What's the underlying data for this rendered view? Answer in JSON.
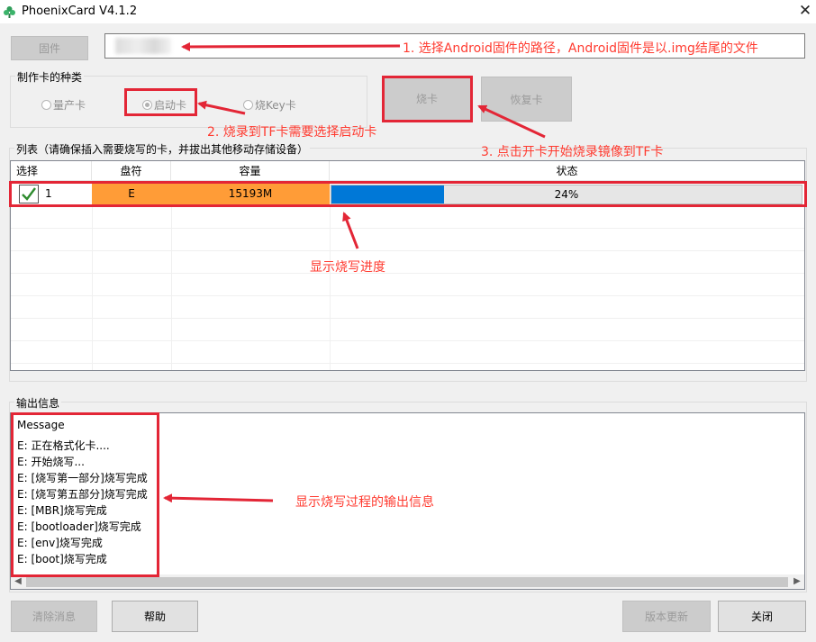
{
  "window": {
    "title": "PhoenixCard V4.1.2",
    "close_symbol": "✕"
  },
  "toolbar": {
    "firmware_button": "固件"
  },
  "card_type": {
    "group_label": "制作卡的种类",
    "options": [
      {
        "label": "量产卡",
        "selected": false
      },
      {
        "label": "启动卡",
        "selected": true
      },
      {
        "label": "烧Key卡",
        "selected": false
      }
    ]
  },
  "actions": {
    "burn_button": "烧卡",
    "restore_button": "恢复卡"
  },
  "list": {
    "group_label": "列表（请确保插入需要烧写的卡，并拔出其他移动存储设备）",
    "columns": [
      "选择",
      "盘符",
      "容量",
      "状态"
    ],
    "rows": [
      {
        "index": "1",
        "drive": "E",
        "capacity": "15193M",
        "status": "24%",
        "progress": 0.24,
        "checked": true
      }
    ]
  },
  "output": {
    "group_label": "输出信息",
    "lines": [
      "Message",
      "E: 正在格式化卡....",
      "E: 开始烧写...",
      "E: [烧写第一部分]烧写完成",
      "E: [烧写第五部分]烧写完成",
      "E: [MBR]烧写完成",
      "E: [bootloader]烧写完成",
      "E: [env]烧写完成",
      "E: [boot]烧写完成"
    ]
  },
  "bottom": {
    "clear_button": "清除消息",
    "help_button": "帮助",
    "update_button": "版本更新",
    "close_button": "关闭"
  },
  "annotations": {
    "a1": "1. 选择Android固件的路径，Android固件是以.img结尾的文件",
    "a2": "2. 烧录到TF卡需要选择启动卡",
    "a3": "3. 点击开卡开始烧录镜像到TF卡",
    "a4": "显示烧写进度",
    "a5": "显示烧写过程的输出信息"
  },
  "colors": {
    "annotation_red": "#e32636",
    "progress_blue": "#0078d7",
    "drive_orange": "#ff9c37",
    "check_green": "#2e8b2e"
  },
  "icons": {
    "app": "phoenix-app-icon",
    "check": "checkmark-icon",
    "arrow": "red-arrow-icon"
  }
}
